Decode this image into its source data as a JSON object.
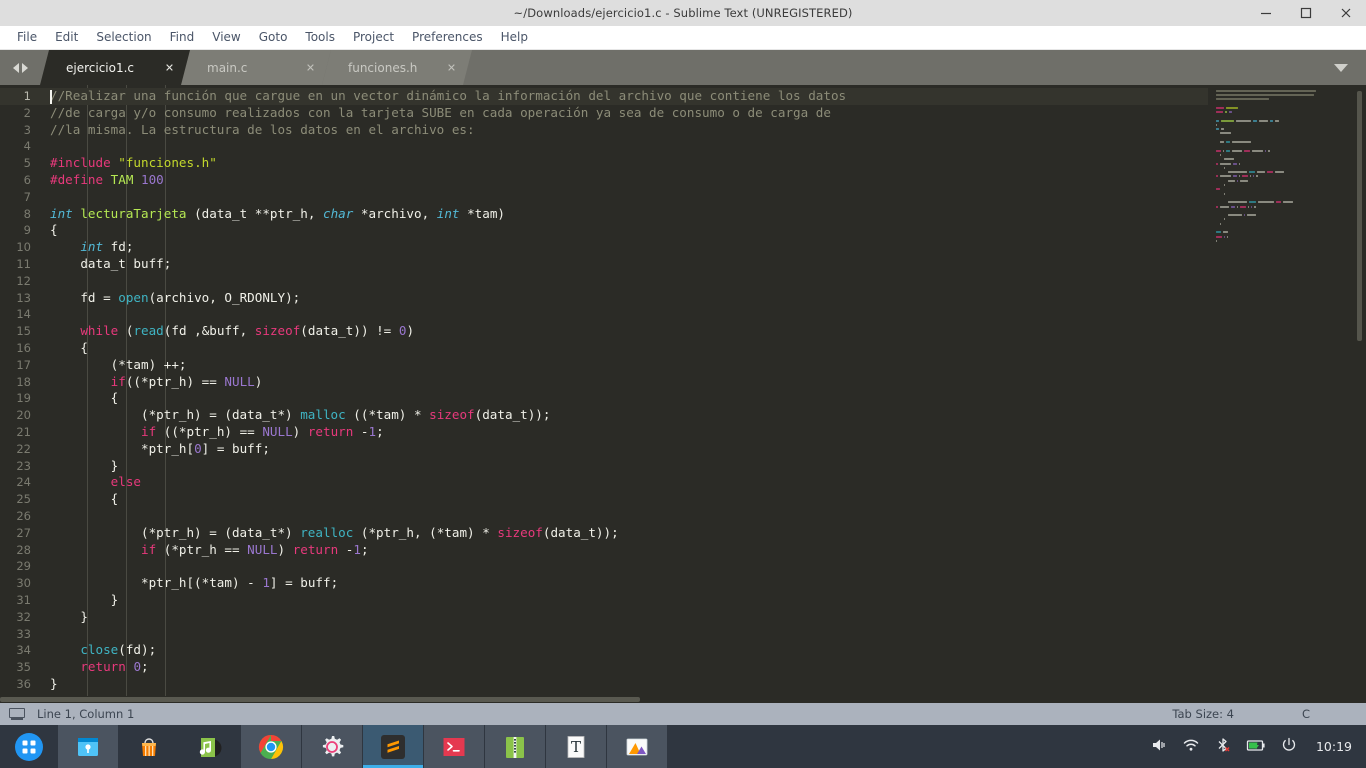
{
  "window": {
    "title": "~/Downloads/ejercicio1.c - Sublime Text (UNREGISTERED)",
    "controls": {
      "minimize": "minimize-icon",
      "maximize": "maximize-icon",
      "close": "close-icon"
    }
  },
  "menubar": {
    "items": [
      "File",
      "Edit",
      "Selection",
      "Find",
      "View",
      "Goto",
      "Tools",
      "Project",
      "Preferences",
      "Help"
    ]
  },
  "tabbar": {
    "nav_prev": "prev-tab-arrow",
    "nav_next": "next-tab-arrow",
    "overflow": "tab-overflow-caret",
    "close_glyph": "✕",
    "tabs": [
      {
        "label": "ejercicio1.c",
        "active": true
      },
      {
        "label": "main.c",
        "active": false
      },
      {
        "label": "funciones.h",
        "active": false
      }
    ]
  },
  "editor": {
    "active_line": 1,
    "first_line": 1,
    "lines": [
      {
        "n": 1,
        "tokens": [
          {
            "t": "//Realizar una función que cargue en un vector dinámico la información del archivo que contiene los datos",
            "c": "c-com"
          }
        ]
      },
      {
        "n": 2,
        "tokens": [
          {
            "t": "//de carga y/o consumo realizados con la tarjeta SUBE en cada operación ya sea de consumo o de carga de",
            "c": "c-com"
          }
        ]
      },
      {
        "n": 3,
        "tokens": [
          {
            "t": "//la misma. La estructura de los datos en el archivo es:",
            "c": "c-com"
          }
        ]
      },
      {
        "n": 4,
        "tokens": []
      },
      {
        "n": 5,
        "tokens": [
          {
            "t": "#include ",
            "c": "c-pre"
          },
          {
            "t": "\"funciones.h\"",
            "c": "c-str"
          }
        ]
      },
      {
        "n": 6,
        "tokens": [
          {
            "t": "#define ",
            "c": "c-pre"
          },
          {
            "t": "TAM",
            "c": "c-def"
          },
          {
            "t": " ",
            "c": "c-plain"
          },
          {
            "t": "100",
            "c": "c-num"
          }
        ]
      },
      {
        "n": 7,
        "tokens": []
      },
      {
        "n": 8,
        "tokens": [
          {
            "t": "int",
            "c": "c-type"
          },
          {
            "t": " ",
            "c": "c-plain"
          },
          {
            "t": "lecturaTarjeta",
            "c": "c-def"
          },
          {
            "t": " (data_t **ptr_h, ",
            "c": "c-plain"
          },
          {
            "t": "char",
            "c": "c-type"
          },
          {
            "t": " *archivo, ",
            "c": "c-plain"
          },
          {
            "t": "int",
            "c": "c-type"
          },
          {
            "t": " *tam)",
            "c": "c-plain"
          }
        ]
      },
      {
        "n": 9,
        "tokens": [
          {
            "t": "{",
            "c": "c-plain"
          }
        ]
      },
      {
        "n": 10,
        "tokens": [
          {
            "t": "    ",
            "c": "c-plain"
          },
          {
            "t": "int",
            "c": "c-type"
          },
          {
            "t": " fd;",
            "c": "c-plain"
          }
        ]
      },
      {
        "n": 11,
        "tokens": [
          {
            "t": "    data_t buff;",
            "c": "c-plain"
          }
        ]
      },
      {
        "n": 12,
        "tokens": []
      },
      {
        "n": 13,
        "tokens": [
          {
            "t": "    fd = ",
            "c": "c-plain"
          },
          {
            "t": "open",
            "c": "c-fn"
          },
          {
            "t": "(archivo, O_RDONLY);",
            "c": "c-plain"
          }
        ]
      },
      {
        "n": 14,
        "tokens": []
      },
      {
        "n": 15,
        "tokens": [
          {
            "t": "    ",
            "c": "c-plain"
          },
          {
            "t": "while",
            "c": "c-kw"
          },
          {
            "t": " (",
            "c": "c-plain"
          },
          {
            "t": "read",
            "c": "c-fn"
          },
          {
            "t": "(fd ,&buff, ",
            "c": "c-plain"
          },
          {
            "t": "sizeof",
            "c": "c-kw"
          },
          {
            "t": "(data_t)) != ",
            "c": "c-plain"
          },
          {
            "t": "0",
            "c": "c-num"
          },
          {
            "t": ")",
            "c": "c-plain"
          }
        ]
      },
      {
        "n": 16,
        "tokens": [
          {
            "t": "    {",
            "c": "c-plain"
          }
        ]
      },
      {
        "n": 17,
        "tokens": [
          {
            "t": "        (*tam) ++;",
            "c": "c-plain"
          }
        ]
      },
      {
        "n": 18,
        "tokens": [
          {
            "t": "        ",
            "c": "c-plain"
          },
          {
            "t": "if",
            "c": "c-kw"
          },
          {
            "t": "((*ptr_h) == ",
            "c": "c-plain"
          },
          {
            "t": "NULL",
            "c": "c-const"
          },
          {
            "t": ")",
            "c": "c-plain"
          }
        ]
      },
      {
        "n": 19,
        "tokens": [
          {
            "t": "        {",
            "c": "c-plain"
          }
        ]
      },
      {
        "n": 20,
        "tokens": [
          {
            "t": "            (*ptr_h) = (data_t*) ",
            "c": "c-plain"
          },
          {
            "t": "malloc",
            "c": "c-fn"
          },
          {
            "t": " ((*tam) * ",
            "c": "c-plain"
          },
          {
            "t": "sizeof",
            "c": "c-kw"
          },
          {
            "t": "(data_t));",
            "c": "c-plain"
          }
        ]
      },
      {
        "n": 21,
        "tokens": [
          {
            "t": "            ",
            "c": "c-plain"
          },
          {
            "t": "if",
            "c": "c-kw"
          },
          {
            "t": " ((*ptr_h) == ",
            "c": "c-plain"
          },
          {
            "t": "NULL",
            "c": "c-const"
          },
          {
            "t": ") ",
            "c": "c-plain"
          },
          {
            "t": "return",
            "c": "c-kw"
          },
          {
            "t": " -",
            "c": "c-plain"
          },
          {
            "t": "1",
            "c": "c-num"
          },
          {
            "t": ";",
            "c": "c-plain"
          }
        ]
      },
      {
        "n": 22,
        "tokens": [
          {
            "t": "            *ptr_h[",
            "c": "c-plain"
          },
          {
            "t": "0",
            "c": "c-num"
          },
          {
            "t": "] = buff;",
            "c": "c-plain"
          }
        ]
      },
      {
        "n": 23,
        "tokens": [
          {
            "t": "        }",
            "c": "c-plain"
          }
        ]
      },
      {
        "n": 24,
        "tokens": [
          {
            "t": "        ",
            "c": "c-plain"
          },
          {
            "t": "else",
            "c": "c-kw"
          }
        ]
      },
      {
        "n": 25,
        "tokens": [
          {
            "t": "        {",
            "c": "c-plain"
          }
        ]
      },
      {
        "n": 26,
        "tokens": []
      },
      {
        "n": 27,
        "tokens": [
          {
            "t": "            (*ptr_h) = (data_t*) ",
            "c": "c-plain"
          },
          {
            "t": "realloc",
            "c": "c-fn"
          },
          {
            "t": " (*ptr_h, (*tam) * ",
            "c": "c-plain"
          },
          {
            "t": "sizeof",
            "c": "c-kw"
          },
          {
            "t": "(data_t));",
            "c": "c-plain"
          }
        ]
      },
      {
        "n": 28,
        "tokens": [
          {
            "t": "            ",
            "c": "c-plain"
          },
          {
            "t": "if",
            "c": "c-kw"
          },
          {
            "t": " (*ptr_h == ",
            "c": "c-plain"
          },
          {
            "t": "NULL",
            "c": "c-const"
          },
          {
            "t": ") ",
            "c": "c-plain"
          },
          {
            "t": "return",
            "c": "c-kw"
          },
          {
            "t": " -",
            "c": "c-plain"
          },
          {
            "t": "1",
            "c": "c-num"
          },
          {
            "t": ";",
            "c": "c-plain"
          }
        ]
      },
      {
        "n": 29,
        "tokens": []
      },
      {
        "n": 30,
        "tokens": [
          {
            "t": "            *ptr_h[(*tam) - ",
            "c": "c-plain"
          },
          {
            "t": "1",
            "c": "c-num"
          },
          {
            "t": "] = buff;",
            "c": "c-plain"
          }
        ]
      },
      {
        "n": 31,
        "tokens": [
          {
            "t": "        }",
            "c": "c-plain"
          }
        ]
      },
      {
        "n": 32,
        "tokens": [
          {
            "t": "    }",
            "c": "c-plain"
          }
        ]
      },
      {
        "n": 33,
        "tokens": []
      },
      {
        "n": 34,
        "tokens": [
          {
            "t": "    ",
            "c": "c-plain"
          },
          {
            "t": "close",
            "c": "c-fn"
          },
          {
            "t": "(fd);",
            "c": "c-plain"
          }
        ]
      },
      {
        "n": 35,
        "tokens": [
          {
            "t": "    ",
            "c": "c-plain"
          },
          {
            "t": "return",
            "c": "c-kw"
          },
          {
            "t": " ",
            "c": "c-plain"
          },
          {
            "t": "0",
            "c": "c-num"
          },
          {
            "t": ";",
            "c": "c-plain"
          }
        ]
      },
      {
        "n": 36,
        "tokens": [
          {
            "t": "}",
            "c": "c-plain"
          }
        ]
      }
    ]
  },
  "statusbar": {
    "icon": "screen-icon",
    "position": "Line 1, Column 1",
    "tab_size": "Tab Size: 4",
    "syntax": "C"
  },
  "taskbar": {
    "start": "app-menu-icon",
    "items": [
      {
        "name": "file-manager-icon",
        "active": false
      },
      {
        "name": "software-store-icon",
        "active": false
      },
      {
        "name": "music-player-icon",
        "active": false
      },
      {
        "name": "google-chrome-icon",
        "active": false
      },
      {
        "name": "settings-gear-icon",
        "active": false
      },
      {
        "name": "sublime-text-icon",
        "active": true
      },
      {
        "name": "terminal-icon",
        "active": false
      },
      {
        "name": "archive-manager-icon",
        "active": false
      },
      {
        "name": "text-editor-icon",
        "active": false
      },
      {
        "name": "image-viewer-icon",
        "active": false
      }
    ],
    "tray": {
      "volume": "volume-icon",
      "wifi": "wifi-icon",
      "bluetooth": "bluetooth-disabled-icon",
      "battery": "battery-charging-icon",
      "power": "power-icon",
      "clock": "10:19"
    }
  },
  "colors": {
    "editor_bg": "#2b2b26",
    "accent": "#3daee9",
    "status_bg": "#abb2bd",
    "taskbar_bg": "#2f3640",
    "keyword": "#e8397c",
    "string": "#c3d82c",
    "comment": "#8c8c78",
    "type": "#53b9d6",
    "number": "#9a77cf"
  }
}
